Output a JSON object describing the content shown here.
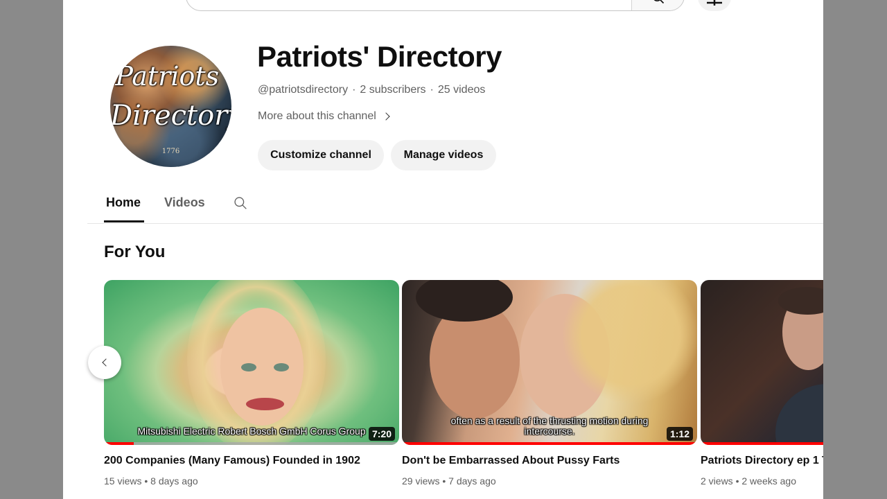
{
  "header": {
    "search": {
      "placeholder": ""
    }
  },
  "channel": {
    "name": "Patriots' Directory",
    "handle": "@patriotsdirectory",
    "subscribers": "2 subscribers",
    "videos_count": "25 videos",
    "separator": "·",
    "more_about": "More about this channel",
    "avatar": {
      "line1": "Patriots'",
      "line2": "Directory",
      "year": "1776"
    },
    "buttons": {
      "customize": "Customize channel",
      "manage": "Manage videos"
    }
  },
  "tabs": [
    {
      "label": "Home",
      "active": true
    },
    {
      "label": "Videos",
      "active": false
    }
  ],
  "section": {
    "title": "For You"
  },
  "videos": [
    {
      "title": "200 Companies (Many Famous) Founded in 1902",
      "views": "15 views",
      "age": "8 days ago",
      "duration": "7:20",
      "caption": "Mitsubishi Electric Robert Bosch GmbH Corus Group",
      "progress": 0.1
    },
    {
      "title": "Don't be Embarrassed About Pussy Farts",
      "views": "29 views",
      "age": "7 days ago",
      "duration": "1:12",
      "caption": "often as a result of the thrusting motion during intercourse.",
      "progress": 1.0
    },
    {
      "title": "Patriots Directory ep 1 T",
      "views": "2 views",
      "age": "2 weeks ago",
      "duration": "",
      "caption": "",
      "progress": 1.0
    }
  ],
  "meta_separator": "•",
  "icons": [
    "search-icon",
    "plus-icon",
    "chevron-right-icon",
    "chevron-left-icon"
  ],
  "colors": {
    "accent": "#ff0000",
    "text": "#0f0f0f",
    "secondary": "#606060",
    "pill": "#f2f2f2"
  }
}
